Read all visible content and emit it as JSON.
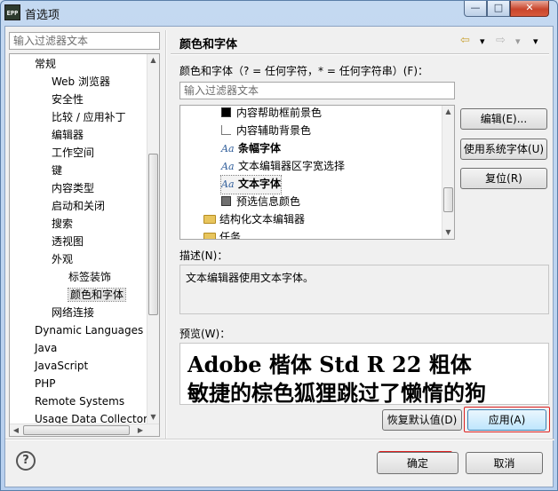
{
  "window": {
    "app_icon_text": "EPP",
    "title": "首选项",
    "controls": {
      "minimize": "—",
      "maximize": "□",
      "close": "✕"
    }
  },
  "left": {
    "filter_placeholder": "输入过滤器文本",
    "tree": [
      {
        "label": "常规",
        "level": 1
      },
      {
        "label": "Web 浏览器",
        "level": 2
      },
      {
        "label": "安全性",
        "level": 2
      },
      {
        "label": "比较 / 应用补丁",
        "level": 2
      },
      {
        "label": "编辑器",
        "level": 2
      },
      {
        "label": "工作空间",
        "level": 2
      },
      {
        "label": "键",
        "level": 2
      },
      {
        "label": "内容类型",
        "level": 2
      },
      {
        "label": "启动和关闭",
        "level": 2
      },
      {
        "label": "搜索",
        "level": 2
      },
      {
        "label": "透视图",
        "level": 2
      },
      {
        "label": "外观",
        "level": 2
      },
      {
        "label": "标签装饰",
        "level": 3
      },
      {
        "label": "颜色和字体",
        "level": 3,
        "selected": true
      },
      {
        "label": "网络连接",
        "level": 2
      },
      {
        "label": "Dynamic Languages",
        "level": 1
      },
      {
        "label": "Java",
        "level": 1
      },
      {
        "label": "JavaScript",
        "level": 1
      },
      {
        "label": "PHP",
        "level": 1
      },
      {
        "label": "Remote Systems",
        "level": 1
      },
      {
        "label": "Usage Data Collector",
        "level": 1
      }
    ]
  },
  "page": {
    "title": "颜色和字体",
    "nav": {
      "back": "⇦",
      "back_menu": "▾",
      "forward": "⇨",
      "forward_menu": "▾",
      "view_menu": "▾"
    },
    "colors_label": "颜色和字体（? = 任何字符，* = 任何字符串）(F)：",
    "filter_placeholder": "输入过滤器文本",
    "font_items": [
      {
        "label": "内容帮助框前景色",
        "icon": "color-black",
        "bold": false
      },
      {
        "label": "内容辅助背景色",
        "icon": "color-white",
        "bold": false
      },
      {
        "label": "条幅字体",
        "icon": "font",
        "bold": true
      },
      {
        "label": "文本编辑器区字宽选择",
        "icon": "font",
        "bold": false
      },
      {
        "label": "文本字体",
        "icon": "font",
        "bold": true,
        "selected": true
      },
      {
        "label": "预选信息颜色",
        "icon": "color-gray",
        "bold": false
      },
      {
        "label": "结构化文本编辑器",
        "icon": "folder",
        "bold": false
      },
      {
        "label": "任务",
        "icon": "folder",
        "bold": false
      }
    ],
    "buttons": {
      "edit": "编辑(E)...",
      "use_system_font": "使用系统字体(U)",
      "reset": "复位(R)"
    },
    "description_label": "描述(N)：",
    "description": "文本编辑器使用文本字体。",
    "preview_label": "预览(W)：",
    "preview_lines": [
      "Adobe 楷体 Std R 22 粗体",
      "敏捷的棕色狐狸跳过了懒惰的狗"
    ],
    "restore_defaults": "恢复默认值(D)",
    "apply": "应用(A)"
  },
  "footer": {
    "help": "?",
    "ok": "确定",
    "cancel": "取消"
  },
  "colors": {
    "highlight_ring": "#dd2222",
    "title_gradient": "#c4d9f1"
  }
}
